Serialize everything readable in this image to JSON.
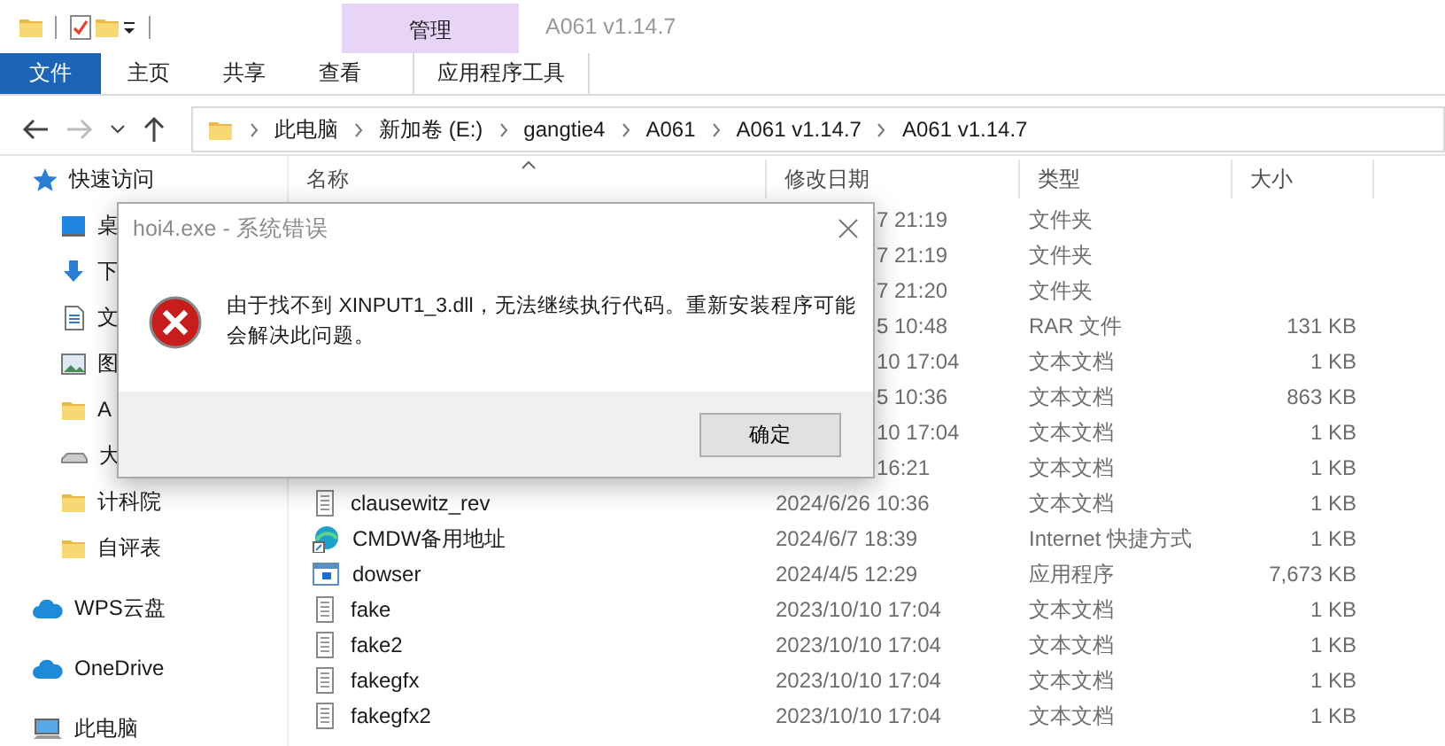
{
  "window": {
    "title": "A061 v1.14.7",
    "context_group": "管理"
  },
  "quick_access_toolbar": [
    {
      "kind": "folder"
    },
    {
      "kind": "properties"
    },
    {
      "kind": "new-folder"
    },
    {
      "kind": "customize"
    }
  ],
  "ribbon_tabs": [
    {
      "label": "文件",
      "kind": "file"
    },
    {
      "label": "主页",
      "kind": "tab"
    },
    {
      "label": "共享",
      "kind": "tab"
    },
    {
      "label": "查看",
      "kind": "tab"
    },
    {
      "label": "应用程序工具",
      "kind": "context"
    }
  ],
  "nav": [
    {
      "kind": "back",
      "disabled": false
    },
    {
      "kind": "forward",
      "disabled": true
    },
    {
      "kind": "recent",
      "disabled": false
    },
    {
      "kind": "up",
      "disabled": false
    }
  ],
  "address": [
    "此电脑",
    "新加卷 (E:)",
    "gangtie4",
    "A061",
    "A061 v1.14.7",
    "A061 v1.14.7"
  ],
  "sidebar": [
    {
      "label": "快速访问",
      "kind": "star",
      "children": [
        {
          "label": "桌",
          "kind": "desktop"
        },
        {
          "label": "下",
          "kind": "download"
        },
        {
          "label": "文",
          "kind": "document"
        },
        {
          "label": "图",
          "kind": "picture"
        },
        {
          "label": "A",
          "kind": "folder"
        },
        {
          "label": "大",
          "kind": "drive"
        },
        {
          "label": "计科院",
          "kind": "folder"
        },
        {
          "label": "自评表",
          "kind": "folder"
        }
      ]
    },
    {
      "label": "WPS云盘",
      "kind": "cloud"
    },
    {
      "label": "OneDrive",
      "kind": "cloud"
    },
    {
      "label": "此电脑",
      "kind": "pc"
    }
  ],
  "columns": [
    {
      "label": "名称",
      "sorted": true
    },
    {
      "label": "修改日期",
      "sorted": false
    },
    {
      "label": "类型",
      "sorted": false
    },
    {
      "label": "大小",
      "sorted": false
    }
  ],
  "files": [
    {
      "date": "7 21:19",
      "type": "文件夹"
    },
    {
      "date": "7 21:19",
      "type": "文件夹"
    },
    {
      "date": "7 21:20",
      "type": "文件夹"
    },
    {
      "date": "5 10:48",
      "type": "RAR 文件",
      "size": "131 KB"
    },
    {
      "date": "10 17:04",
      "type": "文本文档",
      "size": "1 KB"
    },
    {
      "date": "5 10:36",
      "type": "文本文档",
      "size": "863 KB"
    },
    {
      "date": "10 17:04",
      "type": "文本文档",
      "size": "1 KB"
    },
    {
      "date": "16:21",
      "type": "文本文档",
      "size": "1 KB"
    },
    {
      "name": "clausewitz_rev",
      "kind": "text",
      "date": "2024/6/26 10:36",
      "type": "文本文档",
      "size": "1 KB"
    },
    {
      "name": "CMDW备用地址",
      "kind": "shortcut",
      "date": "2024/6/7 18:39",
      "type": "Internet 快捷方式",
      "size": "1 KB"
    },
    {
      "name": "dowser",
      "kind": "app",
      "date": "2024/4/5 12:29",
      "type": "应用程序",
      "size": "7,673 KB"
    },
    {
      "name": "fake",
      "kind": "text",
      "date": "2023/10/10 17:04",
      "type": "文本文档",
      "size": "1 KB"
    },
    {
      "name": "fake2",
      "kind": "text",
      "date": "2023/10/10 17:04",
      "type": "文本文档",
      "size": "1 KB"
    },
    {
      "name": "fakegfx",
      "kind": "text",
      "date": "2023/10/10 17:04",
      "type": "文本文档",
      "size": "1 KB"
    },
    {
      "name": "fakegfx2",
      "kind": "text",
      "date": "2023/10/10 17:04",
      "type": "文本文档",
      "size": "1 KB"
    }
  ],
  "dialog": {
    "title": "hoi4.exe - 系统错误",
    "message": "由于找不到 XINPUT1_3.dll，无法继续执行代码。重新安装程序可能会解决此问题。",
    "button": "确定"
  }
}
